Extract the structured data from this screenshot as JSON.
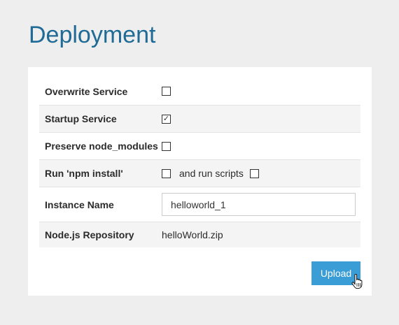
{
  "page": {
    "title": "Deployment"
  },
  "form": {
    "overwrite_service": {
      "label": "Overwrite Service",
      "checked": false
    },
    "startup_service": {
      "label": "Startup Service",
      "checked": true
    },
    "preserve_node_modules": {
      "label": "Preserve node_modules",
      "checked": false
    },
    "run_npm_install": {
      "label": "Run 'npm install'",
      "checked": false,
      "run_scripts_label": "and run scripts",
      "run_scripts_checked": false
    },
    "instance_name": {
      "label": "Instance Name",
      "value": "helloworld_1"
    },
    "repository": {
      "label": "Node.js Repository",
      "value": "helloWorld.zip"
    }
  },
  "actions": {
    "upload_label": "Upload"
  },
  "colors": {
    "title": "#1f6b95",
    "button": "#3a9dd6",
    "alt_row": "#f4f4f4"
  },
  "icons": {
    "cursor": "hand-pointer-icon",
    "checkmark": "checkmark-icon"
  }
}
